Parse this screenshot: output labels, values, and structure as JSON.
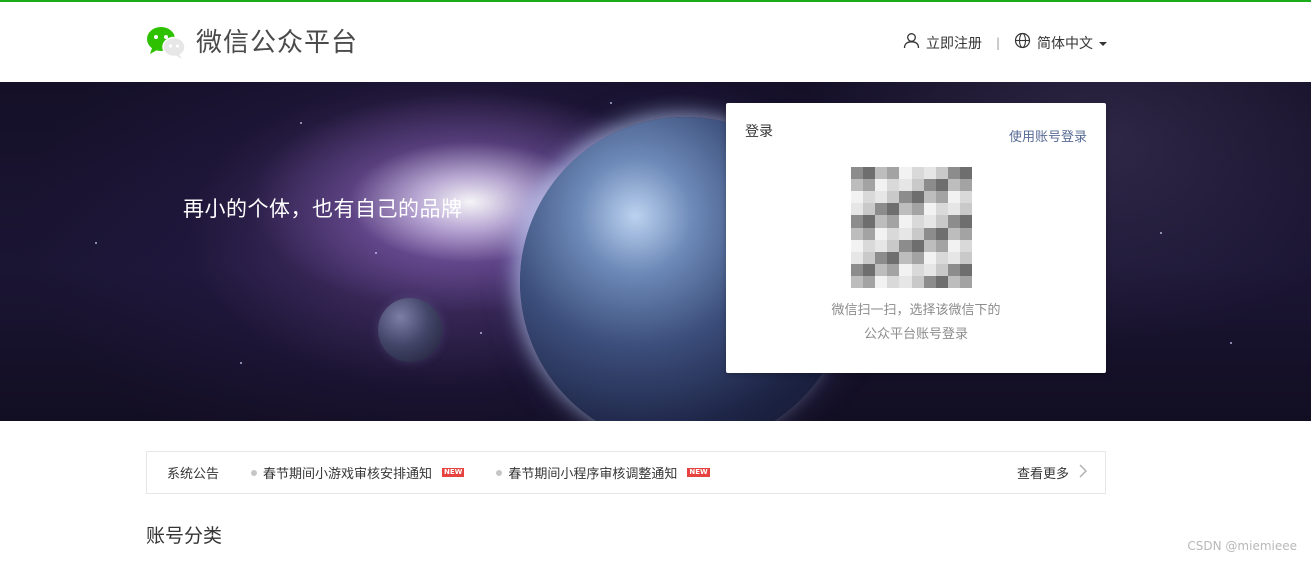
{
  "header": {
    "logo_text": "微信公众平台",
    "register_label": "立即注册",
    "separator": "|",
    "language_label": "简体中文"
  },
  "banner": {
    "slogan": "再小的个体，也有自己的品牌"
  },
  "login": {
    "title": "登录",
    "account_login_link": "使用账号登录",
    "qr_tip_line1": "微信扫一扫，选择该微信下的",
    "qr_tip_line2": "公众平台账号登录"
  },
  "notices": {
    "label": "系统公告",
    "items": [
      {
        "text": "春节期间小游戏审核安排通知",
        "badge": "NEW"
      },
      {
        "text": "春节期间小程序审核调整通知",
        "badge": "NEW"
      }
    ],
    "more_label": "查看更多"
  },
  "section": {
    "title": "账号分类"
  },
  "watermark": "CSDN @miemieee",
  "colors": {
    "accent_green": "#1aad19",
    "link_blue": "#576b95",
    "badge_red": "#e64340"
  }
}
